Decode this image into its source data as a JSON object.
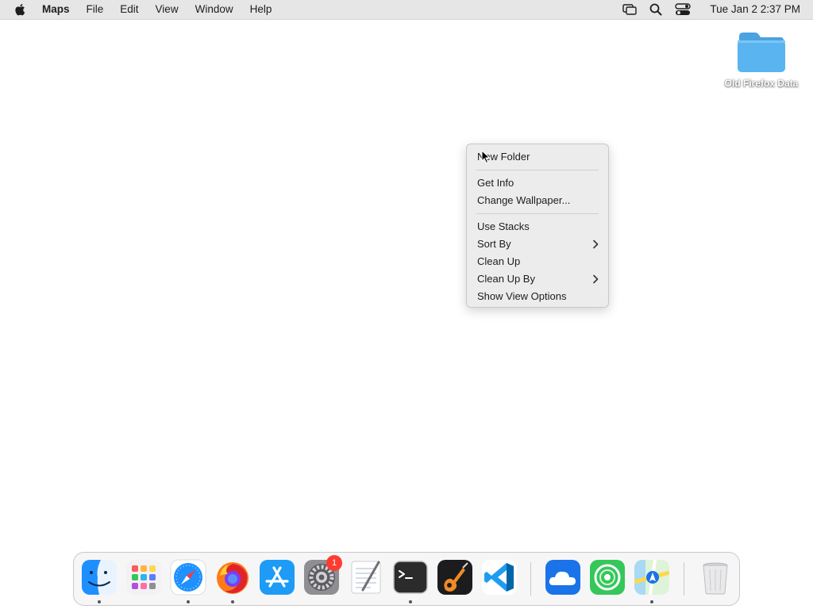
{
  "menubar": {
    "app_name": "Maps",
    "menus": [
      "File",
      "Edit",
      "View",
      "Window",
      "Help"
    ],
    "status_icons": [
      "screen-mirroring-icon",
      "spotlight-search-icon",
      "control-center-icon"
    ],
    "clock": "Tue Jan 2  2:37 PM"
  },
  "desktop": {
    "folder": {
      "label": "Old Firefox Data",
      "icon": "folder-icon",
      "color": "#5ab4f0"
    }
  },
  "context_menu": {
    "items": [
      {
        "label": "New Folder"
      },
      {
        "label": "Get Info"
      },
      {
        "label": "Change Wallpaper..."
      },
      {
        "label": "Use Stacks"
      },
      {
        "label": "Sort By",
        "submenu": true
      },
      {
        "label": "Clean Up"
      },
      {
        "label": "Clean Up By",
        "submenu": true
      },
      {
        "label": "Show View Options"
      }
    ]
  },
  "dock": {
    "apps": [
      {
        "name": "finder-icon",
        "running": true
      },
      {
        "name": "launchpad-icon",
        "running": false
      },
      {
        "name": "safari-icon",
        "running": true
      },
      {
        "name": "firefox-icon",
        "running": true
      },
      {
        "name": "app-store-icon",
        "running": false
      },
      {
        "name": "system-settings-icon",
        "running": false,
        "badge": "1"
      },
      {
        "name": "textedit-icon",
        "running": false
      },
      {
        "name": "terminal-icon",
        "running": true
      },
      {
        "name": "garageband-icon",
        "running": false
      },
      {
        "name": "vscode-icon",
        "running": false
      },
      {
        "name": "weather-icon",
        "running": false
      },
      {
        "name": "find-my-icon",
        "running": false
      },
      {
        "name": "maps-icon",
        "running": true
      },
      {
        "name": "trash-icon",
        "running": false
      }
    ]
  }
}
